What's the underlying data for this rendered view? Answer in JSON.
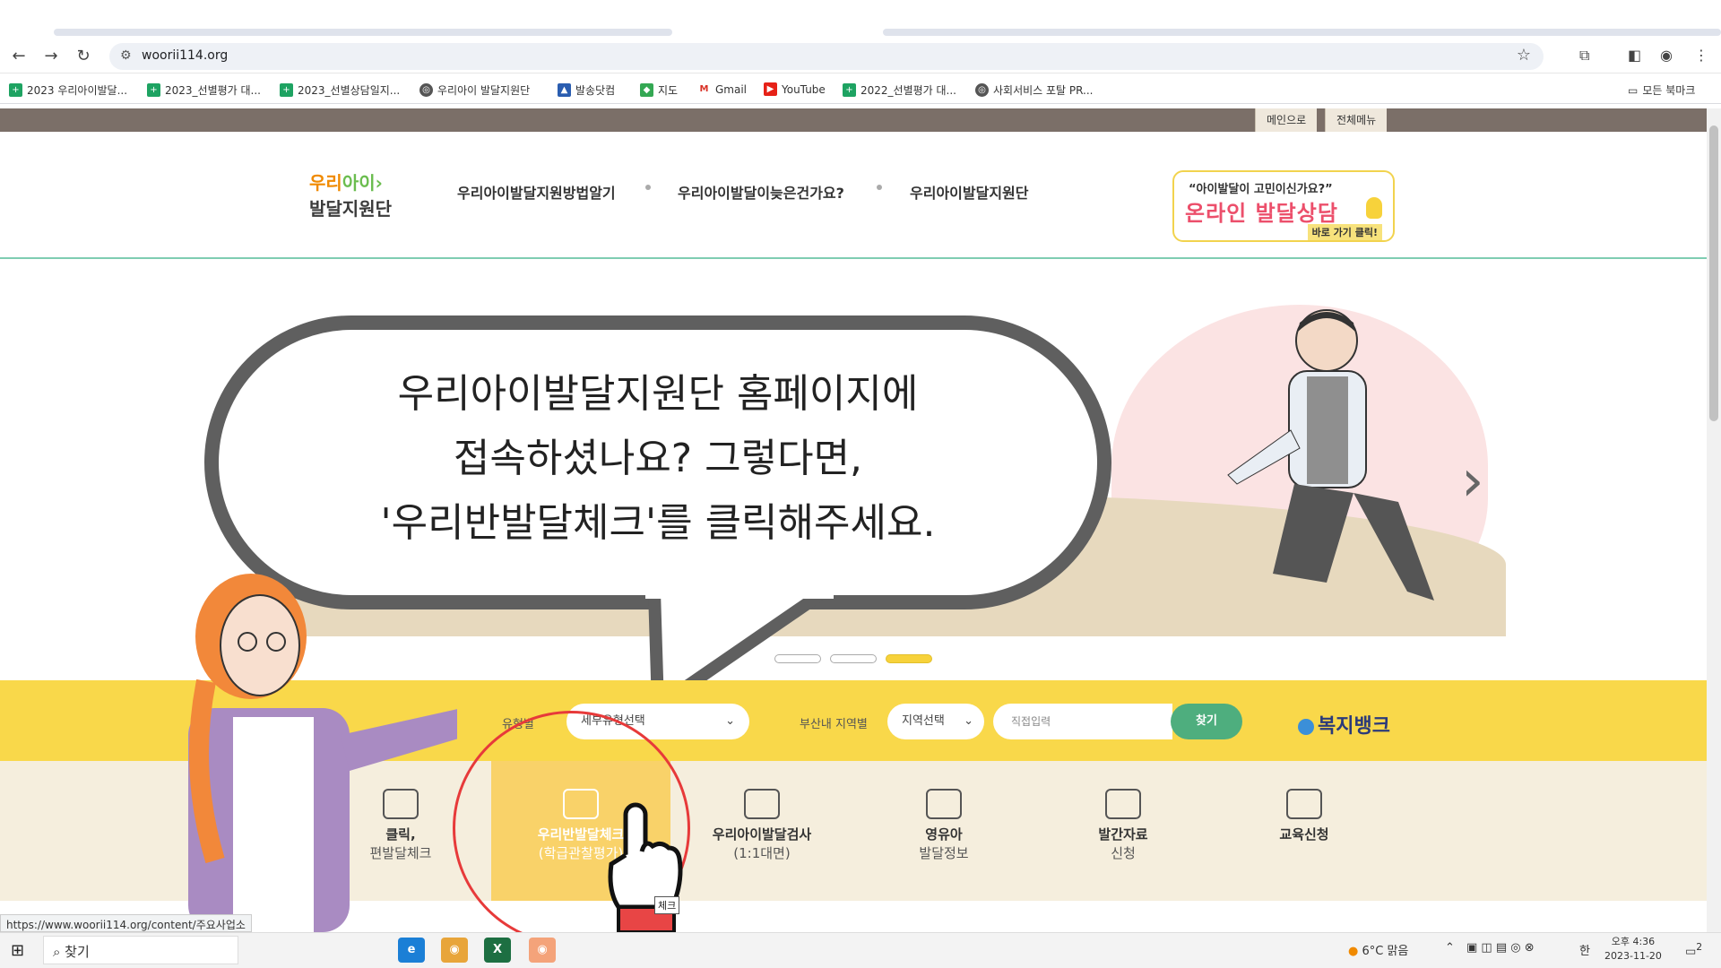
{
  "browser": {
    "url": "woorii114.org",
    "bookmarks": [
      {
        "label": "2023 우리아이발달...",
        "icon": "sheets-icon"
      },
      {
        "label": "2023_선별평가 대...",
        "icon": "sheets-icon"
      },
      {
        "label": "2023_선별상담일지...",
        "icon": "sheets-icon"
      },
      {
        "label": "우리아이 발달지원단",
        "icon": "globe-icon"
      },
      {
        "label": "발송닷컴",
        "icon": "site-icon"
      },
      {
        "label": "지도",
        "icon": "maps-icon"
      },
      {
        "label": "Gmail",
        "icon": "gmail-icon"
      },
      {
        "label": "YouTube",
        "icon": "youtube-icon"
      },
      {
        "label": "2022_선별평가 대...",
        "icon": "sheets-icon"
      },
      {
        "label": "사회서비스 포탈 PR...",
        "icon": "globe-icon"
      }
    ],
    "all_bookmarks": "모든 북마크"
  },
  "site": {
    "top_buttons": {
      "main": "메인으로",
      "all_menu": "전체메뉴"
    },
    "logo": {
      "line1a": "우리",
      "line1b": "아이",
      "line2": "발달지원단"
    },
    "gnb": [
      "우리아이발달지원방법알기",
      "우리아이발달이늦은건가요?",
      "우리아이발달지원단"
    ],
    "consult": {
      "line1": "“아이발달이 고민이신가요?”",
      "line2": "온라인 발달상담",
      "line3": "바로 가기 클릭!"
    },
    "bubble_text": [
      "우리아이발달지원단 홈페이지에",
      "접속하셨나요? 그렇다면,",
      "'우리반발달체크'를 클릭해주세요."
    ],
    "search": {
      "type_label": "유형별",
      "type_select": "세부유형선택",
      "region_label": "부산내 지역별",
      "region_select": "지역선택",
      "direct_placeholder": "직접입력",
      "find_button": "찾기",
      "welfare_bank": "복지뱅크"
    },
    "quick": [
      {
        "t1": "클릭,",
        "t2": "편발달체크",
        "icon": "pen-icon"
      },
      {
        "t1": "우리반발달체크",
        "t2": "(학급관찰평가)",
        "icon": "hand-growth-icon"
      },
      {
        "t1": "우리아이발달검사",
        "t2": "(1:1대면)",
        "icon": "consult-icon"
      },
      {
        "t1": "영유아",
        "t2": "발달정보",
        "icon": "people-icon"
      },
      {
        "t1": "발간자료",
        "t2": "신청",
        "icon": "book-icon"
      },
      {
        "t1": "교육신청",
        "t2": "",
        "icon": "graduation-cap-icon"
      }
    ],
    "tooltip": "체크",
    "status_url": "https://www.woorii114.org/content/주요사업소"
  },
  "taskbar": {
    "search": "찾기",
    "weather": "6°C  맑음",
    "ime": "한",
    "time": "오후 4:36",
    "date": "2023-11-20",
    "notifications": "2"
  }
}
